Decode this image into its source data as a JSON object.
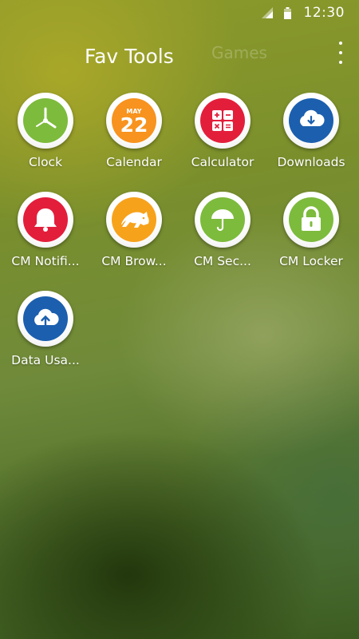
{
  "status_bar": {
    "time": "12:30"
  },
  "header": {
    "tabs": [
      {
        "label": "Fav Tools"
      },
      {
        "label": "Games"
      }
    ]
  },
  "apps": [
    {
      "label": "Clock",
      "icon": "clock-icon",
      "color": "#7dbb3c"
    },
    {
      "label": "Calendar",
      "icon": "calendar-icon",
      "color": "#f7931e",
      "month": "MAY",
      "day": "22"
    },
    {
      "label": "Calculator",
      "icon": "calculator-icon",
      "color": "#e31e3b"
    },
    {
      "label": "Downloads",
      "icon": "downloads-icon",
      "color": "#1c5fae"
    },
    {
      "label": "CM Notifi...",
      "icon": "bell-icon",
      "color": "#e31e3b"
    },
    {
      "label": "CM Brow...",
      "icon": "panther-icon",
      "color": "#f7a21b"
    },
    {
      "label": "CM Sec...",
      "icon": "umbrella-icon",
      "color": "#7dbb3c"
    },
    {
      "label": "CM Locker",
      "icon": "lock-icon",
      "color": "#7dbb3c"
    },
    {
      "label": "Data Usa...",
      "icon": "cloud-upload-icon",
      "color": "#1c5fae"
    }
  ]
}
